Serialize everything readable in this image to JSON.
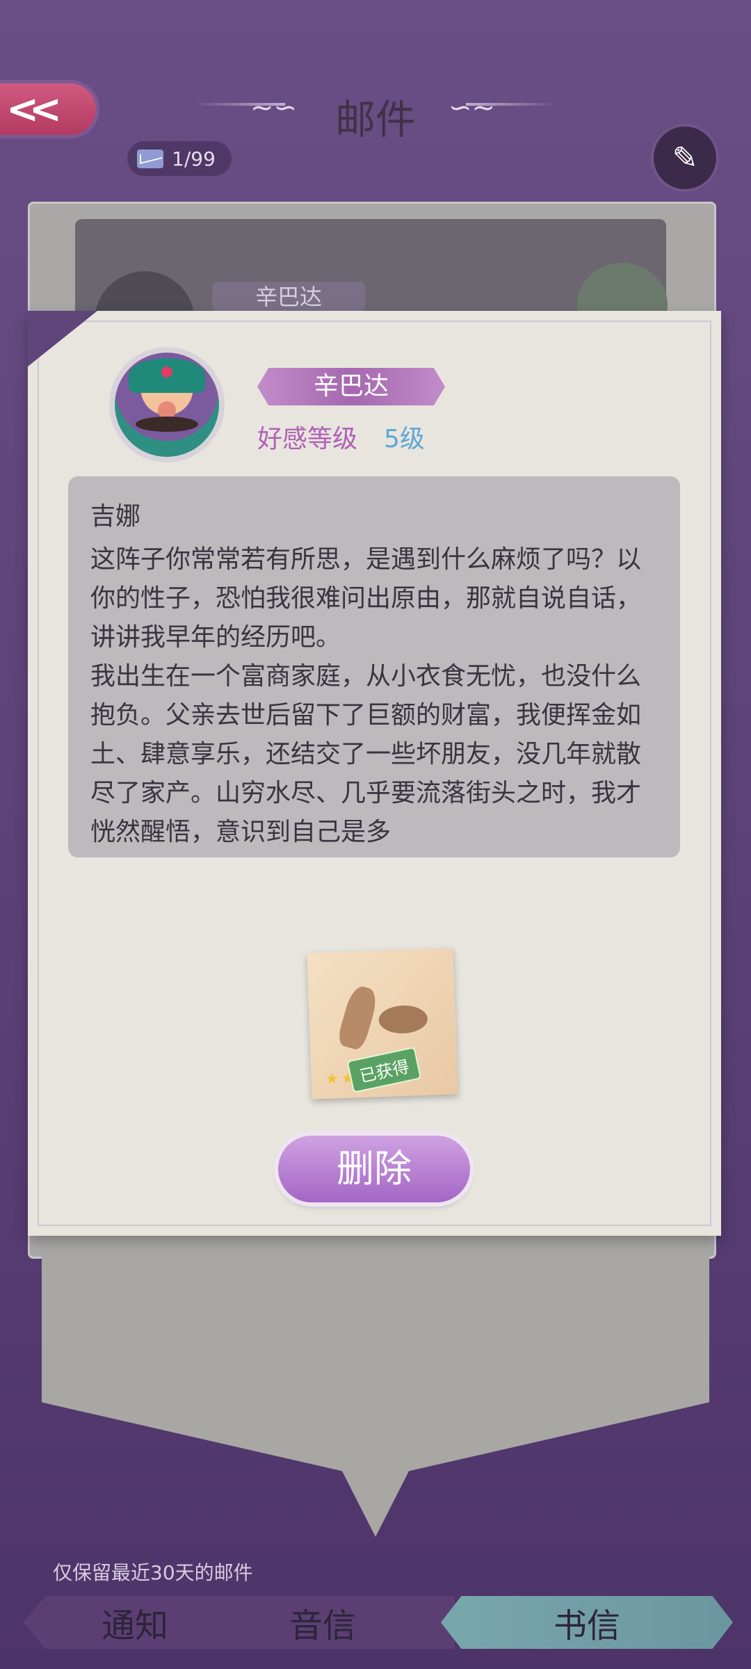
{
  "header": {
    "back_icon": "double-chevron-left-icon",
    "title": "邮件",
    "mail_count": "1/99",
    "edit_icon": "pencil-icon"
  },
  "back_card": {
    "name": "辛巴达"
  },
  "letter": {
    "sender_name": "辛巴达",
    "affinity_label": "好感等级",
    "affinity_level": "5级",
    "recipient": "吉娜",
    "body": "这阵子你常常若有所思，是遇到什么麻烦了吗？以你的性子，恐怕我很难问出原由，那就自说自话，讲讲我早年的经历吧。\n我出生在一个富商家庭，从小衣食无忧，也没什么抱负。父亲去世后留下了巨额的财富，我便挥金如土、肆意享乐，还结交了一些坏朋友，没几年就散尽了家产。山穷水尽、几乎要流落街头之时，我才恍然醒悟，意识到自己是多"
  },
  "reward": {
    "item_icon": "sandals-icon",
    "badge": "已获得",
    "stars_filled": 2,
    "stars_total": 6
  },
  "delete_label": "删除",
  "footer_note": "仅保留最近30天的邮件",
  "tabs": {
    "notify": "通知",
    "voice": "音信",
    "letters": "书信"
  },
  "colors": {
    "accent_purple": "#a366c5",
    "level_blue": "#5ea7d6",
    "badge_green": "#5aa264"
  }
}
